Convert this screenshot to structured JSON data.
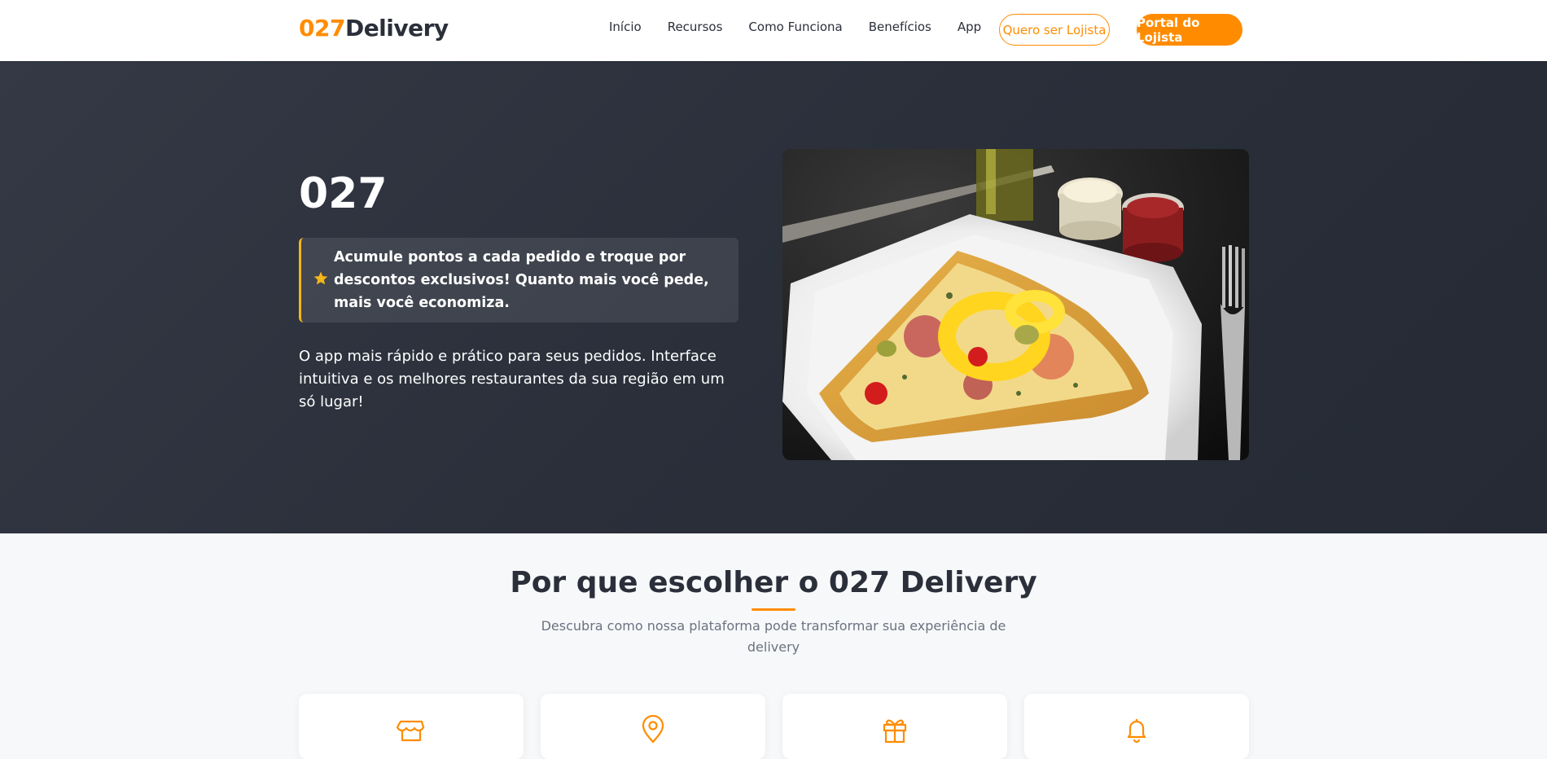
{
  "header": {
    "logo_accent": "027",
    "logo_rest": "Delivery",
    "nav": [
      "Início",
      "Recursos",
      "Como Funciona",
      "Benefícios",
      "App"
    ],
    "cta_outline": "Quero ser Lojista",
    "cta_solid": "Portal do Lojista"
  },
  "hero": {
    "title": "027",
    "promo_icon": "star-icon",
    "promo_text": "Acumule pontos a cada pedido e troque por descontos exclusivos! Quanto mais você pede, mais você economiza.",
    "description": "O app mais rápido e prático para seus pedidos. Interface intuitiva e os melhores restaurantes da sua região em um só lugar!"
  },
  "features": {
    "title": "Por que escolher o 027 Delivery",
    "subtitle": "Descubra como nossa plataforma pode transformar sua experiência de delivery",
    "cards": [
      {
        "icon": "store-icon"
      },
      {
        "icon": "location-pin-icon"
      },
      {
        "icon": "gift-icon"
      },
      {
        "icon": "bell-icon"
      }
    ]
  },
  "colors": {
    "accent": "#ff8c00",
    "hero_bg": "#2d323d",
    "star": "#f5b619"
  }
}
